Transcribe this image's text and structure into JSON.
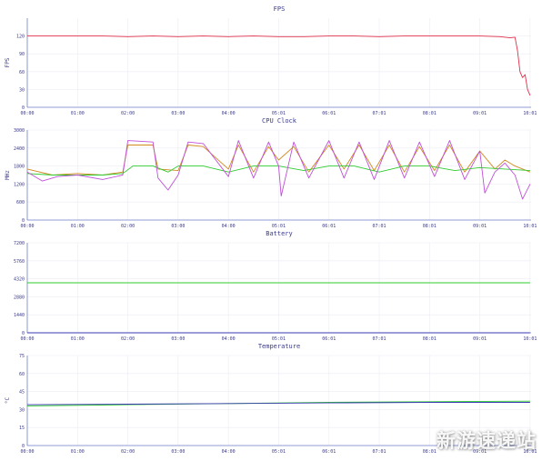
{
  "x_ticks": [
    "00:00",
    "01:00",
    "02:00",
    "03:00",
    "04:00",
    "05:01",
    "06:01",
    "07:01",
    "08:01",
    "09:01",
    "10:01"
  ],
  "watermark": "新游速递站",
  "chart_data": [
    {
      "type": "line",
      "title": "FPS",
      "xlabel": "",
      "ylabel": "FPS",
      "ylim": [
        0,
        150
      ],
      "yticks": [
        0,
        30,
        60,
        90,
        120
      ],
      "ytick_labels": [
        "0",
        "30",
        "60",
        "90",
        "120"
      ],
      "xlim": [
        0,
        10.02
      ],
      "grid": true,
      "series": [
        {
          "color": "#e0304a",
          "x": [
            0,
            0.5,
            1.0,
            1.5,
            2.0,
            2.5,
            3.0,
            3.5,
            4.0,
            4.5,
            5.0,
            5.5,
            6.0,
            6.5,
            7.0,
            7.5,
            8.0,
            8.5,
            9.0,
            9.4,
            9.6,
            9.7,
            9.75,
            9.8,
            9.85,
            9.9,
            9.95,
            10.0
          ],
          "y": [
            120,
            120,
            120,
            120,
            119,
            120,
            119,
            120,
            119,
            120,
            119,
            119,
            120,
            120,
            119,
            120,
            120,
            120,
            120,
            119,
            117,
            118,
            95,
            60,
            50,
            55,
            30,
            20
          ]
        }
      ]
    },
    {
      "type": "line",
      "title": "CPU Clock",
      "xlabel": "",
      "ylabel": "MHz",
      "ylim": [
        0,
        3000
      ],
      "yticks": [
        0,
        600,
        1200,
        1800,
        2400,
        3000
      ],
      "ytick_labels": [
        "0",
        "600",
        "1200",
        "1800",
        "2400",
        "3000"
      ],
      "xlim": [
        0,
        10.02
      ],
      "grid": true,
      "series": [
        {
          "color": "#d08a1e",
          "x": [
            0,
            0.5,
            1.0,
            1.5,
            1.9,
            2.0,
            2.5,
            2.6,
            3.0,
            3.2,
            3.5,
            4.0,
            4.2,
            4.5,
            4.8,
            5.0,
            5.3,
            5.6,
            6.0,
            6.3,
            6.6,
            6.9,
            7.2,
            7.5,
            7.8,
            8.1,
            8.4,
            8.7,
            9.0,
            9.3,
            9.5,
            9.7,
            10.0
          ],
          "y": [
            1700,
            1500,
            1550,
            1500,
            1600,
            2500,
            2500,
            1700,
            1650,
            2500,
            2450,
            1700,
            2500,
            1600,
            2450,
            2000,
            2450,
            1600,
            2500,
            1700,
            2500,
            1650,
            2500,
            1600,
            2450,
            1650,
            2500,
            1600,
            2300,
            1700,
            2000,
            1800,
            1600
          ]
        },
        {
          "color": "#2ecc2e",
          "x": [
            0,
            0.5,
            1.0,
            1.5,
            1.9,
            2.1,
            2.5,
            2.8,
            3.0,
            3.5,
            4.0,
            4.5,
            5.0,
            5.5,
            6.0,
            6.5,
            7.0,
            7.5,
            8.0,
            8.5,
            9.0,
            9.5,
            10.0
          ],
          "y": [
            1550,
            1500,
            1500,
            1500,
            1550,
            1800,
            1800,
            1600,
            1800,
            1800,
            1600,
            1800,
            1800,
            1650,
            1800,
            1800,
            1600,
            1800,
            1800,
            1650,
            1750,
            1700,
            1650
          ]
        },
        {
          "color": "#c050d8",
          "x": [
            0,
            0.3,
            0.6,
            1.0,
            1.5,
            1.9,
            2.0,
            2.5,
            2.6,
            2.8,
            3.0,
            3.2,
            3.5,
            4.0,
            4.2,
            4.5,
            4.8,
            5.0,
            5.05,
            5.3,
            5.6,
            6.0,
            6.3,
            6.6,
            6.9,
            7.2,
            7.5,
            7.8,
            8.1,
            8.4,
            8.7,
            9.0,
            9.1,
            9.3,
            9.5,
            9.7,
            9.85,
            10.0
          ],
          "y": [
            1600,
            1300,
            1450,
            1500,
            1350,
            1500,
            2650,
            2600,
            1400,
            1000,
            1500,
            2600,
            2550,
            1450,
            2650,
            1400,
            2600,
            1800,
            800,
            2600,
            1400,
            2650,
            1400,
            2600,
            1350,
            2650,
            1400,
            2600,
            1450,
            2650,
            1350,
            2300,
            900,
            1600,
            1900,
            1500,
            700,
            1200
          ]
        }
      ]
    },
    {
      "type": "line",
      "title": "Battery",
      "xlabel": "",
      "ylabel": "",
      "ylim": [
        0,
        7200
      ],
      "yticks": [
        0,
        1440,
        2880,
        4320,
        5760,
        7200
      ],
      "ytick_labels": [
        "0",
        "1440",
        "2880",
        "4320",
        "5760",
        "7200"
      ],
      "xlim": [
        0,
        10.02
      ],
      "grid": true,
      "series": [
        {
          "color": "#2ecc2e",
          "x": [
            0,
            10.0
          ],
          "y": [
            4000,
            4000
          ]
        },
        {
          "color": "#3a3ab0",
          "x": [
            0,
            10.0
          ],
          "y": [
            0,
            0
          ]
        }
      ]
    },
    {
      "type": "line",
      "title": "Temperature",
      "xlabel": "",
      "ylabel": "°C",
      "ylim": [
        0,
        75
      ],
      "yticks": [
        0,
        15,
        30,
        45,
        60,
        75
      ],
      "ytick_labels": [
        "0",
        "15",
        "30",
        "45",
        "60",
        "75"
      ],
      "xlim": [
        0,
        10.02
      ],
      "grid": true,
      "series": [
        {
          "color": "#2ecc2e",
          "x": [
            0,
            2.0,
            4.0,
            6.0,
            8.0,
            10.0
          ],
          "y": [
            33,
            34,
            35,
            36,
            36.5,
            37
          ]
        },
        {
          "color": "#3a3ab0",
          "x": [
            0,
            2.0,
            4.0,
            6.0,
            8.0,
            10.0
          ],
          "y": [
            34,
            34.5,
            35,
            35.5,
            36,
            36
          ]
        }
      ]
    }
  ]
}
